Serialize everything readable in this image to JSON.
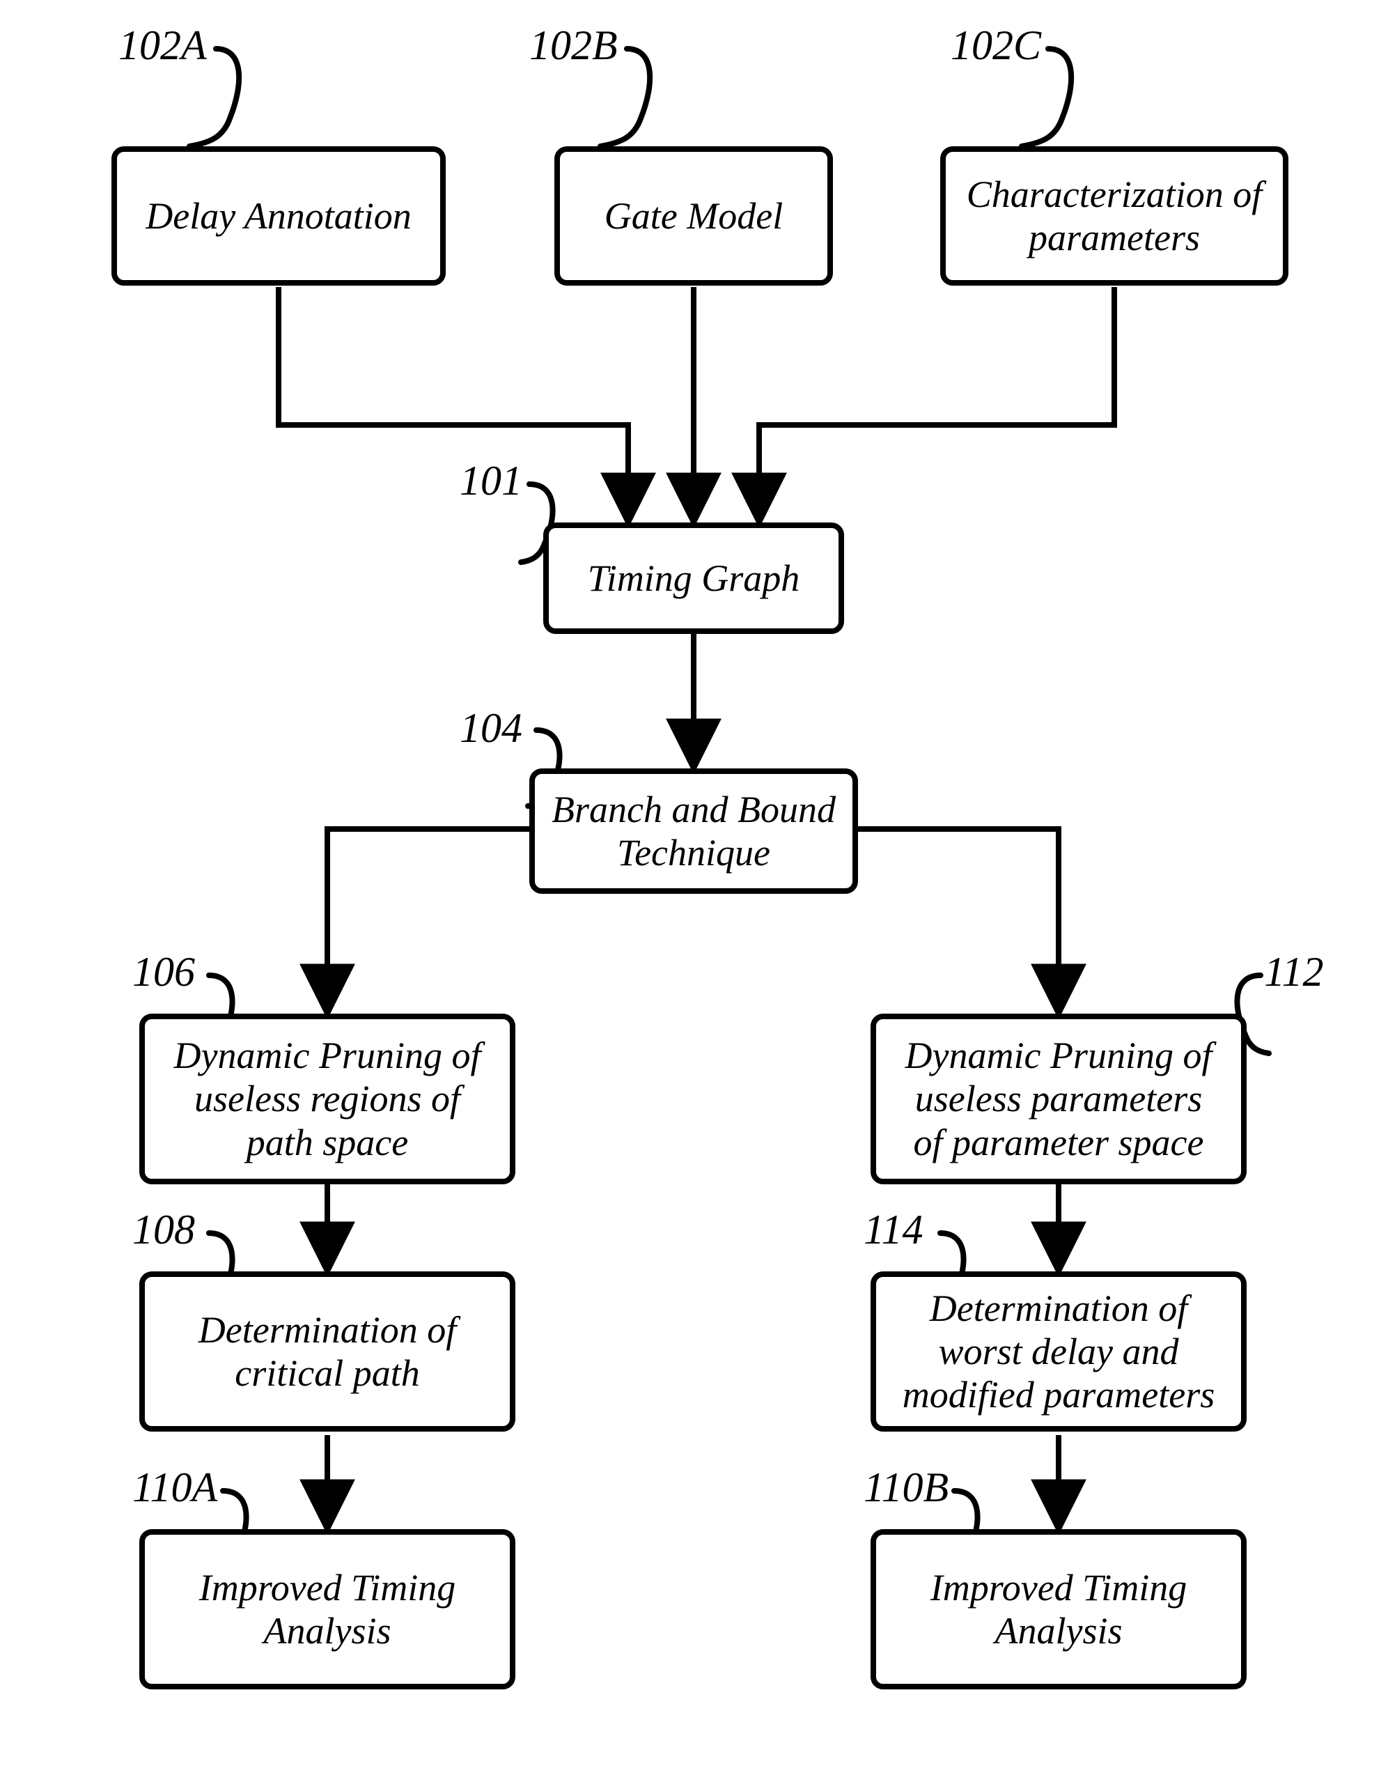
{
  "labels": {
    "l102A": "102A",
    "l102B": "102B",
    "l102C": "102C",
    "l101": "101",
    "l104": "104",
    "l106": "106",
    "l108": "108",
    "l110A": "110A",
    "l112": "112",
    "l114": "114",
    "l110B": "110B"
  },
  "boxes": {
    "b102A": "Delay Annotation",
    "b102B": "Gate Model",
    "b102C": "Characterization of\nparameters",
    "b101": "Timing Graph",
    "b104": "Branch and Bound\nTechnique",
    "b106": "Dynamic Pruning of\nuseless regions of\npath space",
    "b108": "Determination of\ncritical path",
    "b110A": "Improved Timing\nAnalysis",
    "b112": "Dynamic Pruning of\nuseless parameters\nof parameter space",
    "b114": "Determination of\nworst delay and\nmodified parameters",
    "b110B": "Improved Timing\nAnalysis"
  }
}
